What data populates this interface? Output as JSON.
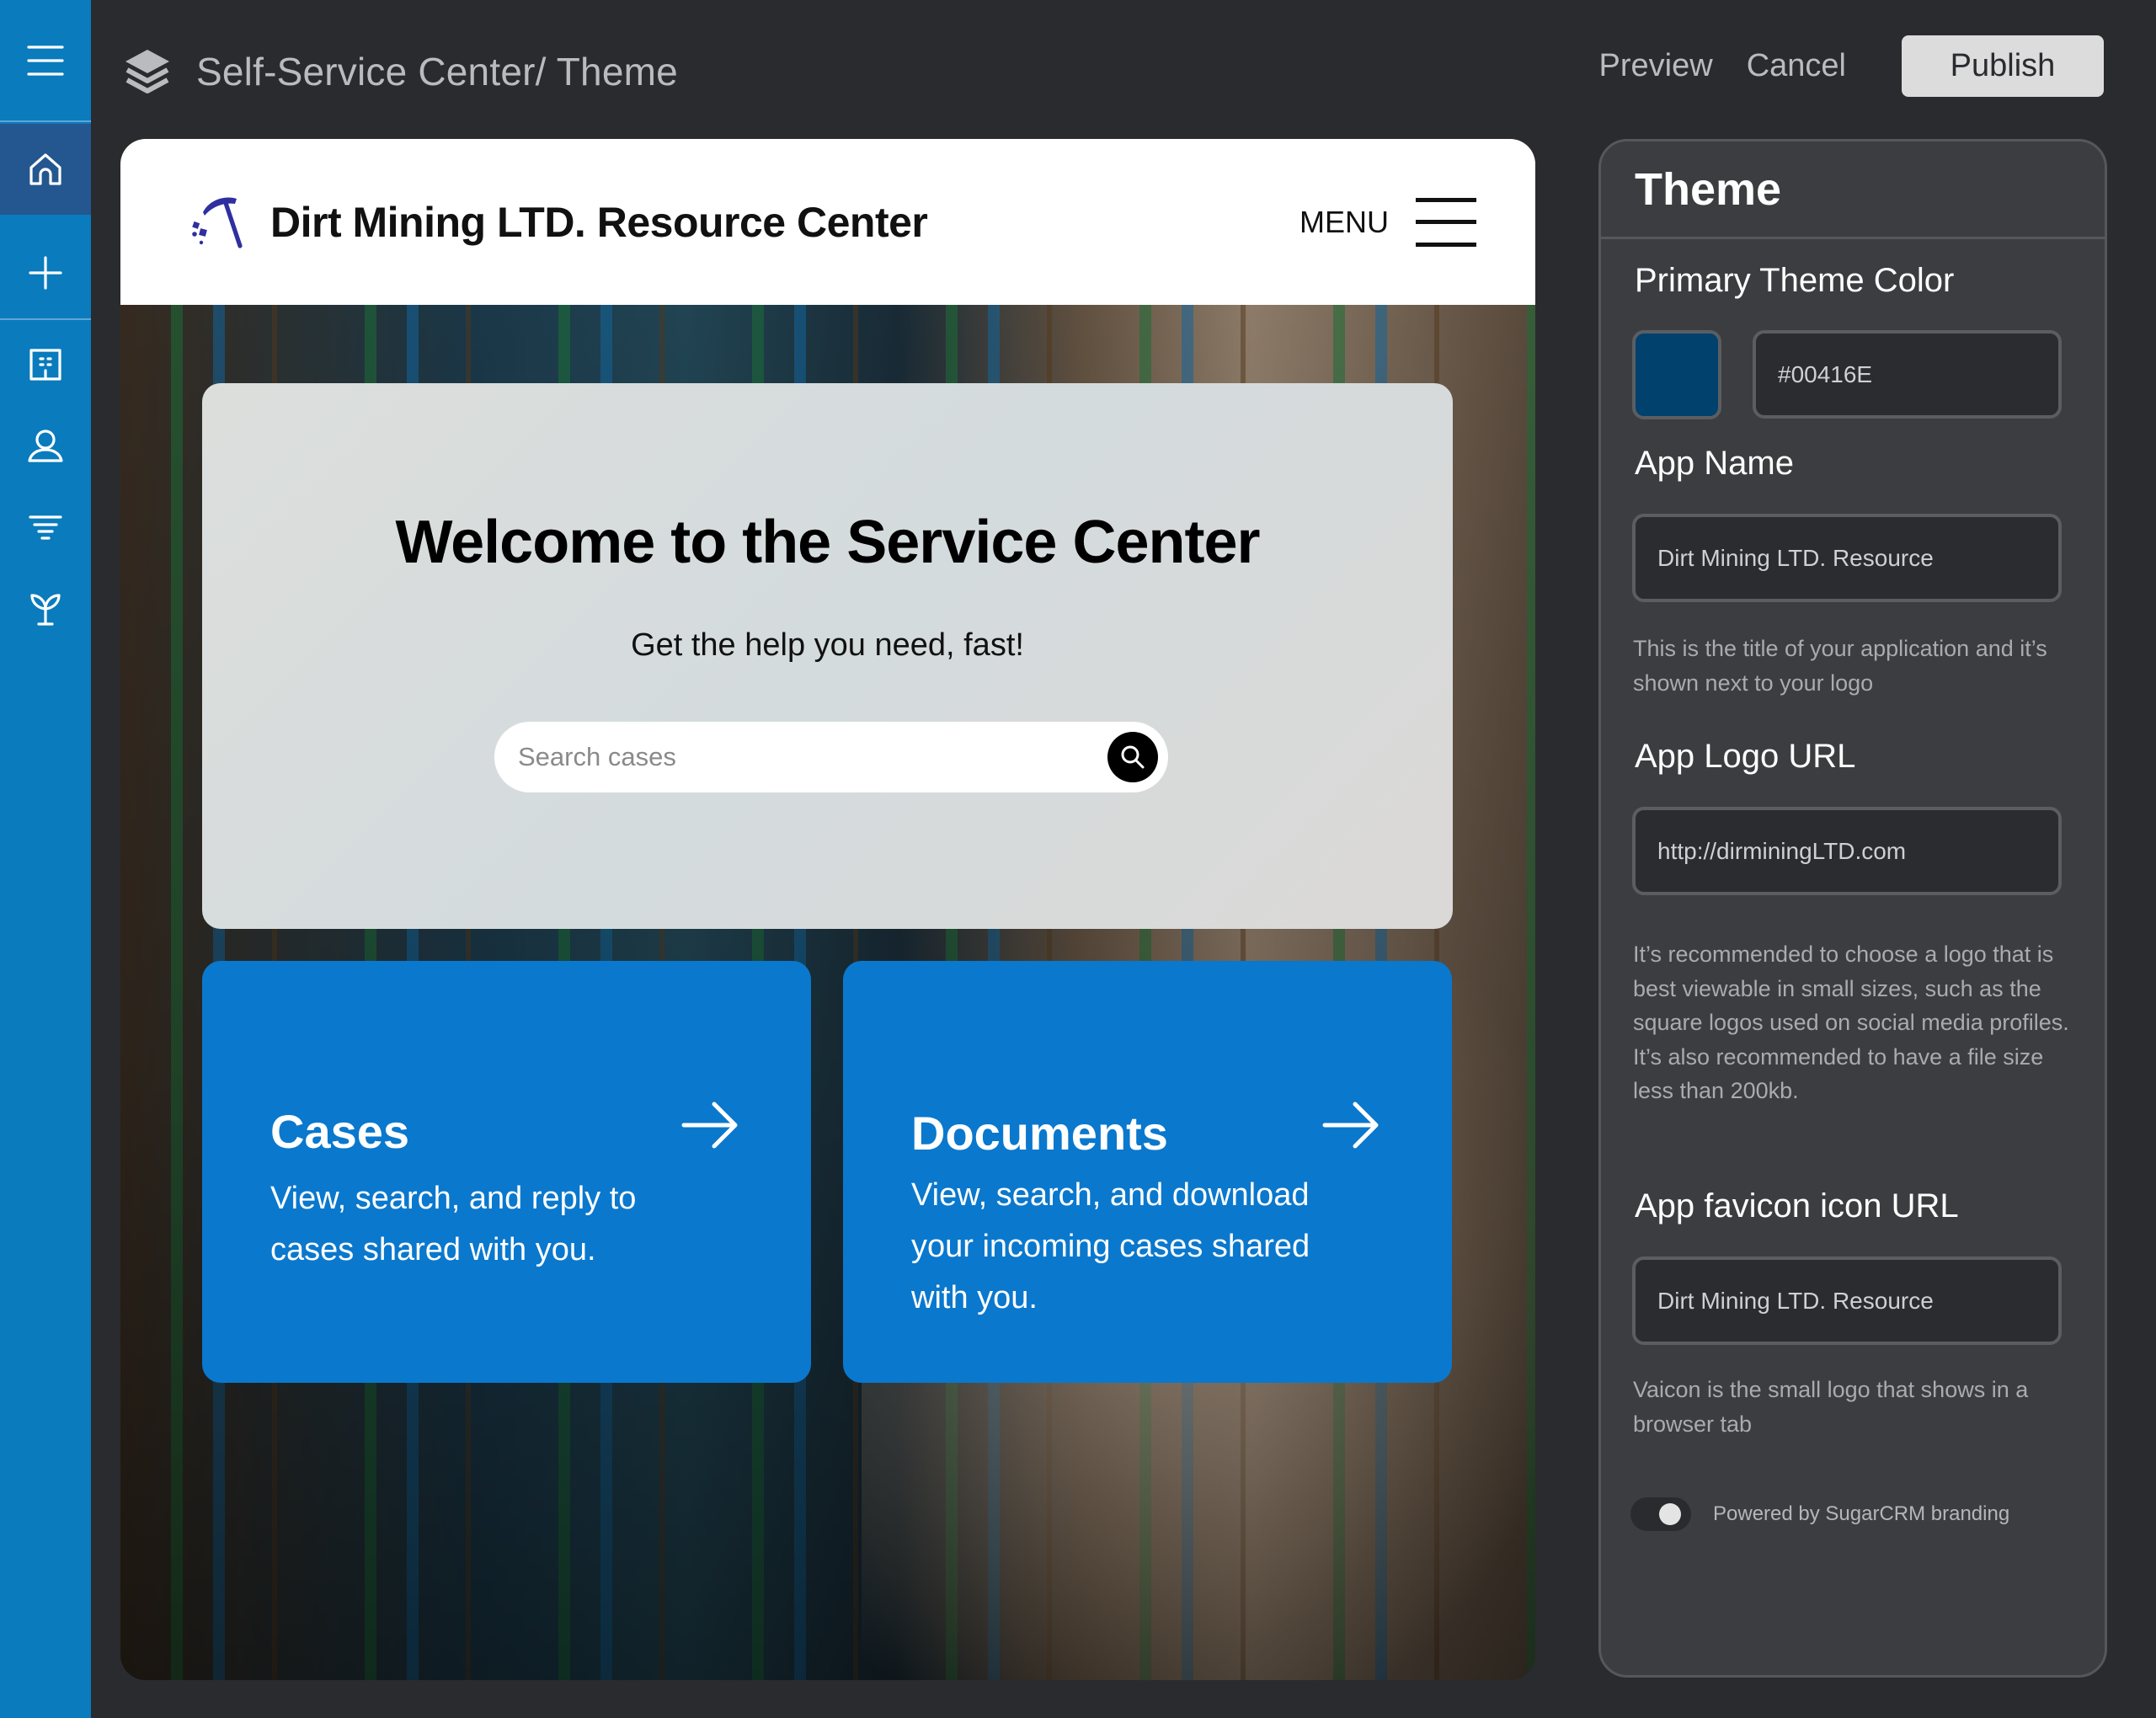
{
  "sidebar": {
    "items": [
      {
        "id": "menu",
        "icon": "hamburger-menu-icon"
      },
      {
        "id": "home",
        "icon": "home-icon",
        "active": true
      },
      {
        "id": "add",
        "icon": "plus-icon"
      },
      {
        "id": "building",
        "icon": "building-icon"
      },
      {
        "id": "user",
        "icon": "user-icon"
      },
      {
        "id": "filter",
        "icon": "filter-icon"
      },
      {
        "id": "sprout",
        "icon": "sprout-icon"
      }
    ],
    "colors": {
      "background": "#0a7bbd",
      "active": "#24578f"
    }
  },
  "topbar": {
    "icon": "layers-icon",
    "title": "Self-Service Center/ Theme",
    "preview_label": "Preview",
    "cancel_label": "Cancel",
    "publish_label": "Publish"
  },
  "preview": {
    "header": {
      "logo": "pickaxe-logo-icon",
      "app_name": "Dirt Mining LTD. Resource Center",
      "menu_label": "MENU"
    },
    "hero": {
      "title": "Welcome to the Service Center",
      "subtitle": "Get the help you need, fast!",
      "search_placeholder": "Search cases"
    },
    "tiles": [
      {
        "title": "Cases",
        "description": "View, search, and reply to cases shared with you."
      },
      {
        "title": "Documents",
        "description": "View, search, and download your incoming cases shared with you."
      }
    ],
    "colors": {
      "tile": "#0a78cd",
      "logo": "#2f2fa0"
    }
  },
  "panel": {
    "title": "Theme",
    "primary_color_label": "Primary Theme Color",
    "primary_color_value": "#00416E",
    "app_name_label": "App Name",
    "app_name_value": "Dirt Mining LTD. Resource",
    "app_name_help": "This is the title of your application and it’s shown next to your logo",
    "logo_url_label": "App Logo URL",
    "logo_url_value": "http://dirminingLTD.com",
    "logo_url_help": "It’s recommended to choose a logo that is best viewable in small sizes, such as the square logos used on social media profiles. It’s also recommended to have a file size less than 200kb.",
    "favicon_label": "App favicon icon URL",
    "favicon_value": "Dirt Mining LTD. Resource",
    "favicon_help": "Vaicon is the small logo that shows in a browser tab",
    "branding_toggle_label": "Powered by SugarCRM branding",
    "branding_toggle_on": true
  }
}
